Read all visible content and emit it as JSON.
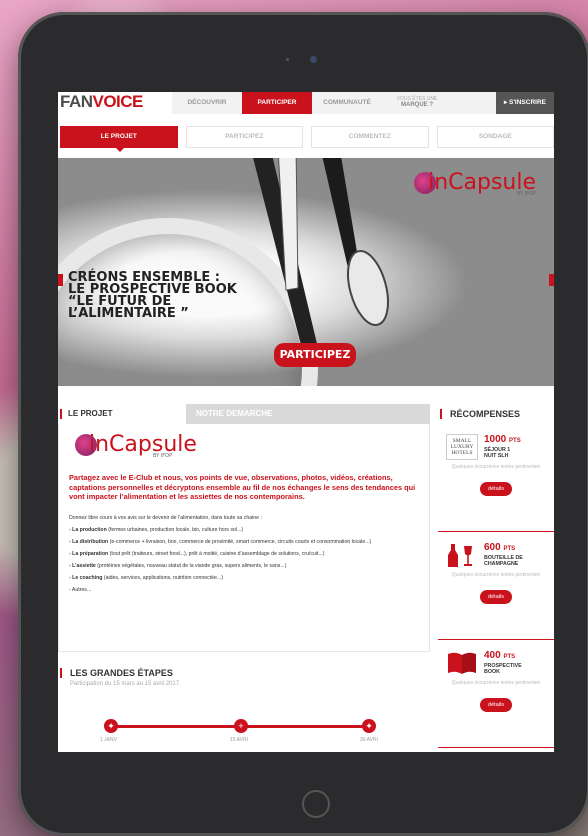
{
  "nav": {
    "logo_part1": "FAN",
    "logo_part2": "VOICE",
    "items": [
      "DÉCOUVRIR",
      "PARTICIPER",
      "COMMUNAUTÉ"
    ],
    "marque_line1": "VOUS ÊTES UNE",
    "marque_line2": "MARQUE ?",
    "inscrire": "▸  S'INSCRIRE"
  },
  "subtabs": [
    "LE PROJET",
    "PARTICIPEZ",
    "COMMENTEZ",
    "SONDAGE"
  ],
  "hero": {
    "brand": "inCapsule",
    "byifop": "BY IFOP",
    "title_lines": [
      "CRÉONS ENSEMBLE :",
      "LE PROSPECTIVE BOOK",
      "“LE FUTUR DE",
      "L’ALIMENTAIRE ”"
    ],
    "button": "PARTICIPEZ"
  },
  "project": {
    "tab1": "LE PROJET",
    "tab2": "NOTRE DEMARCHE",
    "brand": "inCapsule",
    "byifop": "BY IFOP",
    "intro": "Partagez avec le E-Club et nous, vos points de vue, observations, photos, vidéos, créations, captations personnelles et décryptons ensemble au fil de nos échanges le sens des tendances qui vont impacter l’alimentation et les assiettes de nos contemporains.",
    "lead": "Donnez libre cours à vos avis sur le devenir de l’alimentation, dans toute sa chaine :",
    "items": [
      {
        "bold": "- La production",
        "text": " (fermes urbaines, production locale, bio, culture hors sol...)"
      },
      {
        "bold": "- La distribution",
        "text": " (e-commerce + livraison, box, commerce de proximité, smart commerce, circuits courts et consommation locale...)"
      },
      {
        "bold": "- La préparation",
        "text": " (tout prêt (traiteurs, street food...), prêt à moitié, cuisine d’assemblage de solutions, cru/cuit...)"
      },
      {
        "bold": "- L’assiette",
        "text": " (protéines végétales, nouveau statut de la viande gras, supers aliments, le sans...)"
      },
      {
        "bold": "- Le coaching",
        "text": " (aides, services, applications, nutrition connectée...)"
      },
      {
        "bold": "",
        "text": "- Autres..."
      }
    ]
  },
  "etapes": {
    "title": "LES GRANDES ÉTAPES",
    "subtitle": "Participation du 15 mars au 15 avril 2017.",
    "labels": [
      "1 JANV",
      "15 AVRI",
      "30 AVRI"
    ]
  },
  "rewards": {
    "title": "RÉCOMPENSES",
    "items": [
      {
        "pts": "1000",
        "unit": "PTS",
        "name_lines": [
          "SÉJOUR 1",
          "NUIT SLH"
        ],
        "sub": "Quelques occurrence textes pertinentes",
        "button": "détails",
        "icon": "hotel-logo-icon"
      },
      {
        "pts": "600",
        "unit": "PTS",
        "name_lines": [
          "BOUTEILLE DE",
          "CHAMPAGNE"
        ],
        "sub": "Quelques occurrence textes pertinentes",
        "button": "détails",
        "icon": "champagne-icon"
      },
      {
        "pts": "400",
        "unit": "PTS",
        "name_lines": [
          "PROSPECTIVE",
          "BOOK"
        ],
        "sub": "Quelques occurrence textes pertinentes",
        "button": "détails",
        "icon": "book-icon"
      }
    ],
    "hotel_logo_lines": [
      "SMALL",
      "LUXURY",
      "HOTELS"
    ]
  }
}
